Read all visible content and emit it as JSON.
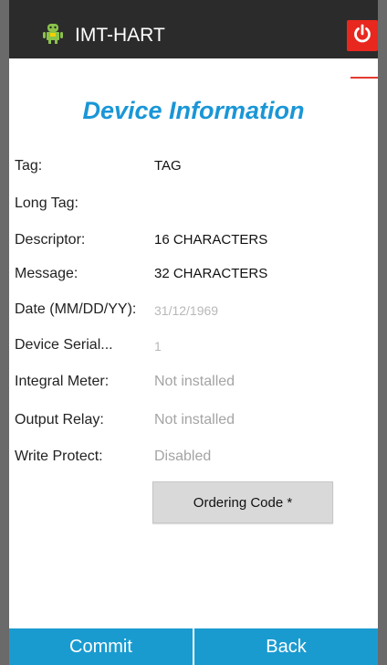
{
  "actionbar": {
    "title": "IMT-HART",
    "app_icon": "android-robot-icon",
    "power_icon": "power-icon",
    "power_color": "#e8281f"
  },
  "page": {
    "title": "Device Information",
    "title_color": "#1a96d6"
  },
  "fields": [
    {
      "label": "Tag:",
      "value": "TAG"
    },
    {
      "label": "Long Tag:",
      "value": ""
    },
    {
      "label": "Descriptor:",
      "value": "16 CHARACTERS"
    },
    {
      "label": "Message:",
      "value": "32 CHARACTERS"
    },
    {
      "label": "Date (MM/DD/YY):",
      "value": "31/12/1969"
    },
    {
      "label": "Device Serial...",
      "value": "1"
    },
    {
      "label": "Integral Meter:",
      "value": "Not installed"
    },
    {
      "label": "Output Relay:",
      "value": "Not installed"
    },
    {
      "label": "Write Protect:",
      "value": "Disabled"
    }
  ],
  "ordering_button": "Ordering Code *",
  "bottom": {
    "commit_label": "Commit",
    "back_label": "Back",
    "bar_color": "#1a9bd0"
  }
}
